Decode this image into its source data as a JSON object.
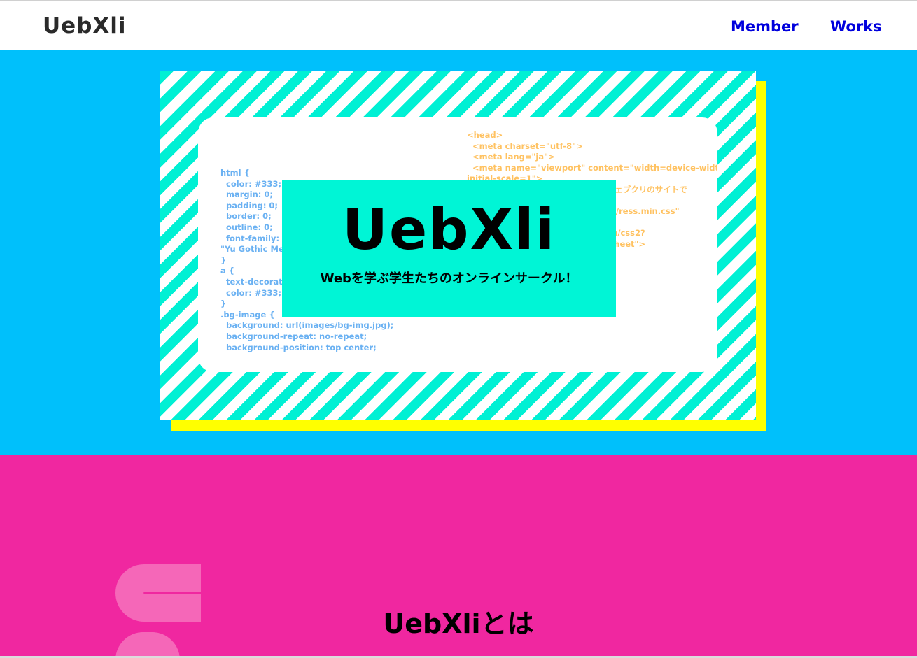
{
  "header": {
    "logo": "UebXli",
    "nav": [
      {
        "label": "Member"
      },
      {
        "label": "Works"
      }
    ]
  },
  "hero": {
    "title": "UebXli",
    "subtitle": "Webを学ぶ学生たちのオンラインサークル！",
    "css_code": "html {\n  color: #333;\n  margin: 0;\n  padding: 0;\n  border: 0;\n  outline: 0;\n  font-family: \"Y\n\"Yu Gothic Med\n}\na {\n  text-decoratio\n  color: #333;\n}\n.bg-image {\n  background: url(images/bg-img.jpg);\n  background-repeat: no-repeat;\n  background-position: top center;",
    "html_code": "<head>\n  <meta charset=\"utf-8\">\n  <meta lang=\"ja\">\n  <meta name=\"viewport\" content=\"width=device-width,\ninitial-scale=1\">\n                                              =\"ウェブクリのサイトで\n\n                                              /dist/ress.min.css\"\n\n                                              .com/css2?\n                                              ylesheet\">\n                                              ss\">"
  },
  "about": {
    "title": "UebXliとは"
  },
  "colors": {
    "nav_link": "#0000dd",
    "hero_bg": "#00c0fb",
    "stripe": "#00f0d4",
    "shadow": "#ffff00",
    "about_bg": "#f027a0"
  }
}
